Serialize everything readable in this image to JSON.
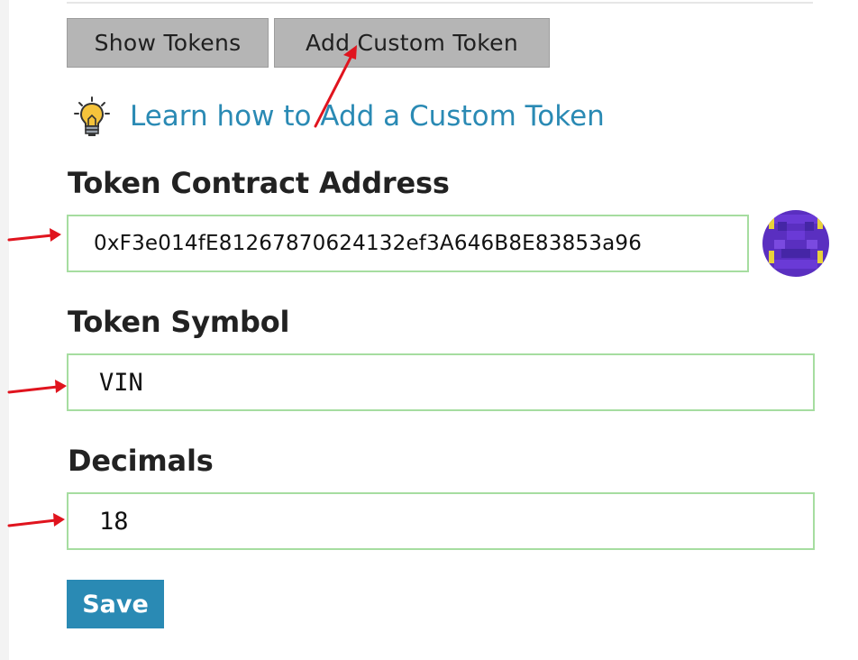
{
  "tabs": {
    "show_tokens": "Show Tokens",
    "add_custom_token": "Add Custom Token"
  },
  "help": {
    "link_text": "Learn how to Add a Custom Token",
    "icon": "lightbulb-icon"
  },
  "form": {
    "address": {
      "label": "Token Contract Address",
      "value": "0xF3e014fE81267870624132ef3A646B8E83853a96"
    },
    "symbol": {
      "label": "Token Symbol",
      "value": "VIN"
    },
    "decimals": {
      "label": "Decimals",
      "value": "18"
    },
    "save_label": "Save"
  },
  "colors": {
    "accent": "#2a8ab4",
    "tab_bg": "#b5b5b5",
    "input_border": "#a6dda0",
    "annotation_arrow": "#e0141e",
    "avatar_purple": "#5a2fc0",
    "avatar_yellow": "#e8d23a"
  }
}
